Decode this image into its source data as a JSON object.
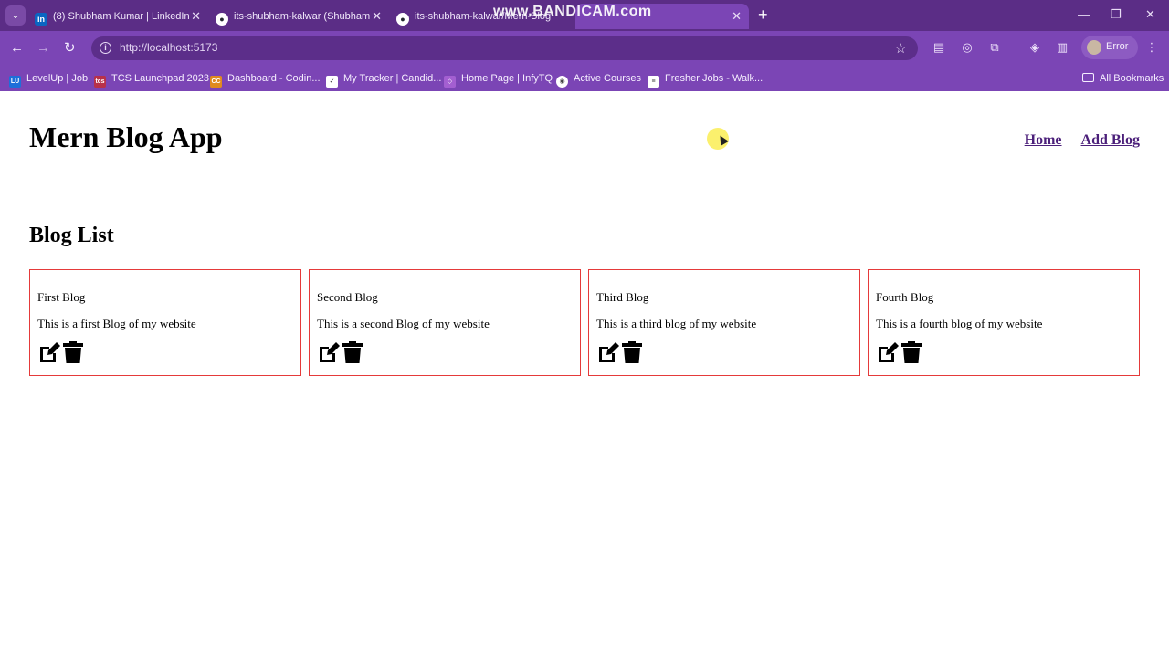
{
  "browser": {
    "tabs": [
      {
        "title": "(8) Shubham Kumar | LinkedIn",
        "icon": "linkedin-icon"
      },
      {
        "title": "its-shubham-kalwar (Shubham",
        "icon": "github-icon"
      },
      {
        "title": "its-shubham-kalwar/Mern-Blog",
        "icon": "github-icon"
      }
    ],
    "watermark": "www.BANDICAM.com",
    "url": "http://localhost:5173",
    "profile_label": "Error",
    "bookmarks": [
      {
        "label": "LevelUp | Job",
        "badge": "LU",
        "color": "#1e6fd9"
      },
      {
        "label": "TCS Launchpad 2023",
        "badge": "tcs",
        "color": "#b8314a"
      },
      {
        "label": "Dashboard - Codin...",
        "badge": "CC",
        "color": "#e08a1e"
      },
      {
        "label": "My Tracker | Candid...",
        "badge": "✓",
        "color": "#ffffff"
      },
      {
        "label": "Home Page | InfyTQ",
        "badge": "◇",
        "color": "#a35fd1"
      },
      {
        "label": "Active Courses",
        "badge": "◉",
        "color": "#ffffff"
      },
      {
        "label": "Fresher Jobs - Walk...",
        "badge": "≡",
        "color": "#ffffff"
      }
    ],
    "all_bookmarks": "All Bookmarks"
  },
  "app": {
    "title": "Mern Blog App",
    "nav": [
      "Home",
      "Add Blog"
    ],
    "list_title": "Blog List",
    "blogs": [
      {
        "title": "First Blog",
        "description": "This is a first Blog of my website"
      },
      {
        "title": "Second Blog",
        "description": "This is a second Blog of my website"
      },
      {
        "title": "Third Blog",
        "description": "This is a third blog of my website"
      },
      {
        "title": "Fourth Blog",
        "description": "This is a fourth blog of my website"
      }
    ],
    "icons": {
      "edit": "edit-icon",
      "delete": "trash-icon"
    },
    "card_border_color": "#e53a3a",
    "link_color": "#4b1f7a"
  },
  "theme": {
    "tabstrip": "#5b2d86",
    "toolbar": "#7b45b5"
  }
}
